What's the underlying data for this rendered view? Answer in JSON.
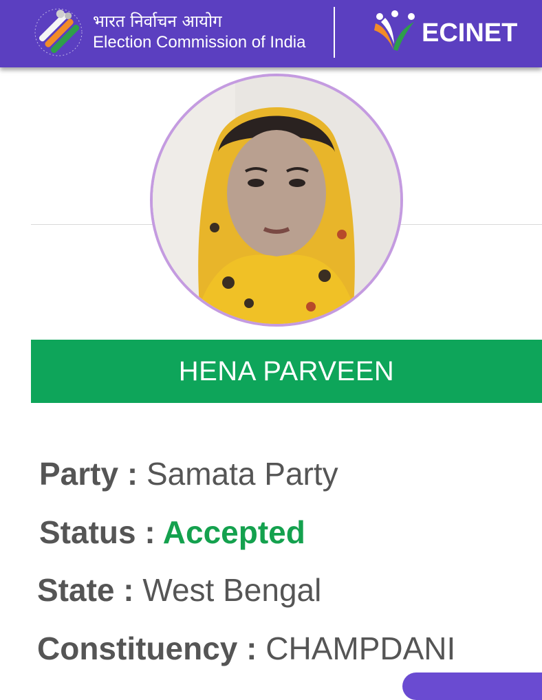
{
  "header": {
    "hindi_title": "भारत निर्वाचन आयोग",
    "english_title": "Election Commission of India",
    "ecinet_label": "ECINET",
    "background_color": "#5b3fc0",
    "eci_logo_icon": "eci-logo-icon",
    "ecinet_logo_icon": "ecinet-logo-icon"
  },
  "candidate": {
    "photo": "candidate-photo",
    "name": "HENA PARVEEN",
    "banner_color": "#0ea55a",
    "details": [
      {
        "label": "Party",
        "separator": " : ",
        "value": "Samata Party"
      },
      {
        "label": "Status",
        "separator": " : ",
        "value": "Accepted",
        "value_color": "#14a14e"
      },
      {
        "label": "State",
        "separator": " : ",
        "value": "West Bengal"
      },
      {
        "label": "Constituency",
        "separator": " : ",
        "value": "CHAMPDANI"
      }
    ]
  }
}
